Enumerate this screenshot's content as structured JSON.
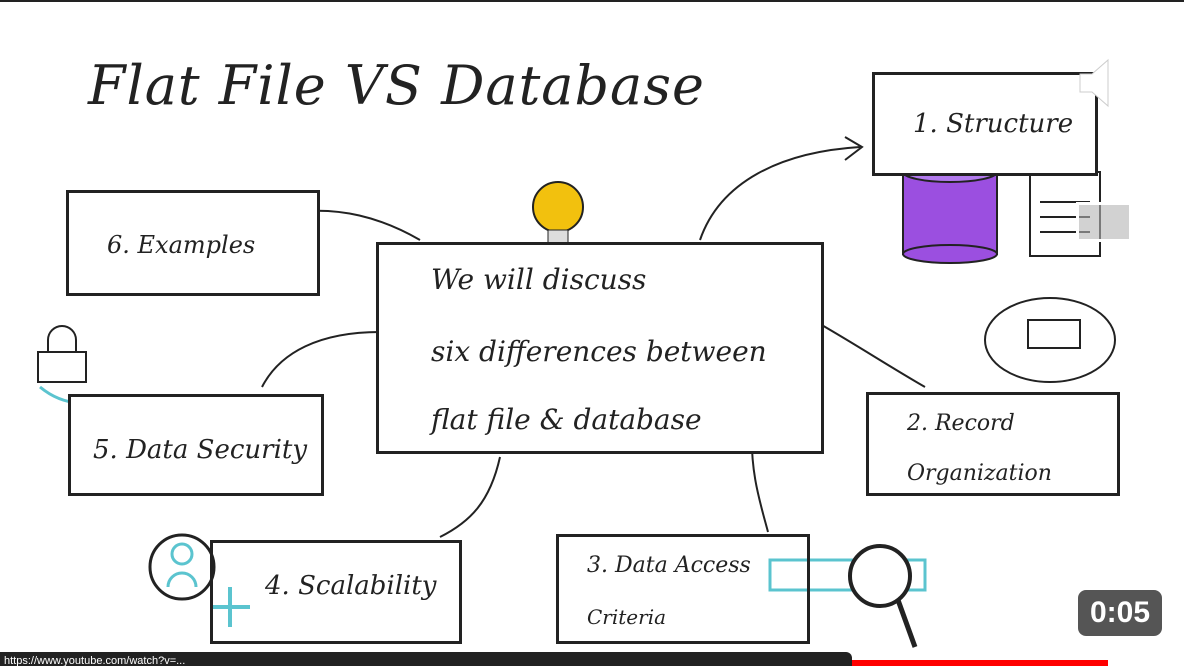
{
  "slide": {
    "title": "Flat File VS Database",
    "center": [
      "We will discuss",
      "six differences between",
      "flat file & database"
    ],
    "items": [
      "1. Structure",
      "2. Record",
      "Organization",
      "3. Data Access",
      "Criteria",
      "4. Scalability",
      "5. Data Security",
      "6. Examples"
    ]
  },
  "player": {
    "timestamp": "0:05",
    "status_url": "https://www.youtube.com/watch?v=...",
    "progress_fraction": 0.0
  },
  "colors": {
    "purple": "#9b4fe0",
    "teal": "#5bc4cf",
    "bulb": "#f2c10e"
  }
}
